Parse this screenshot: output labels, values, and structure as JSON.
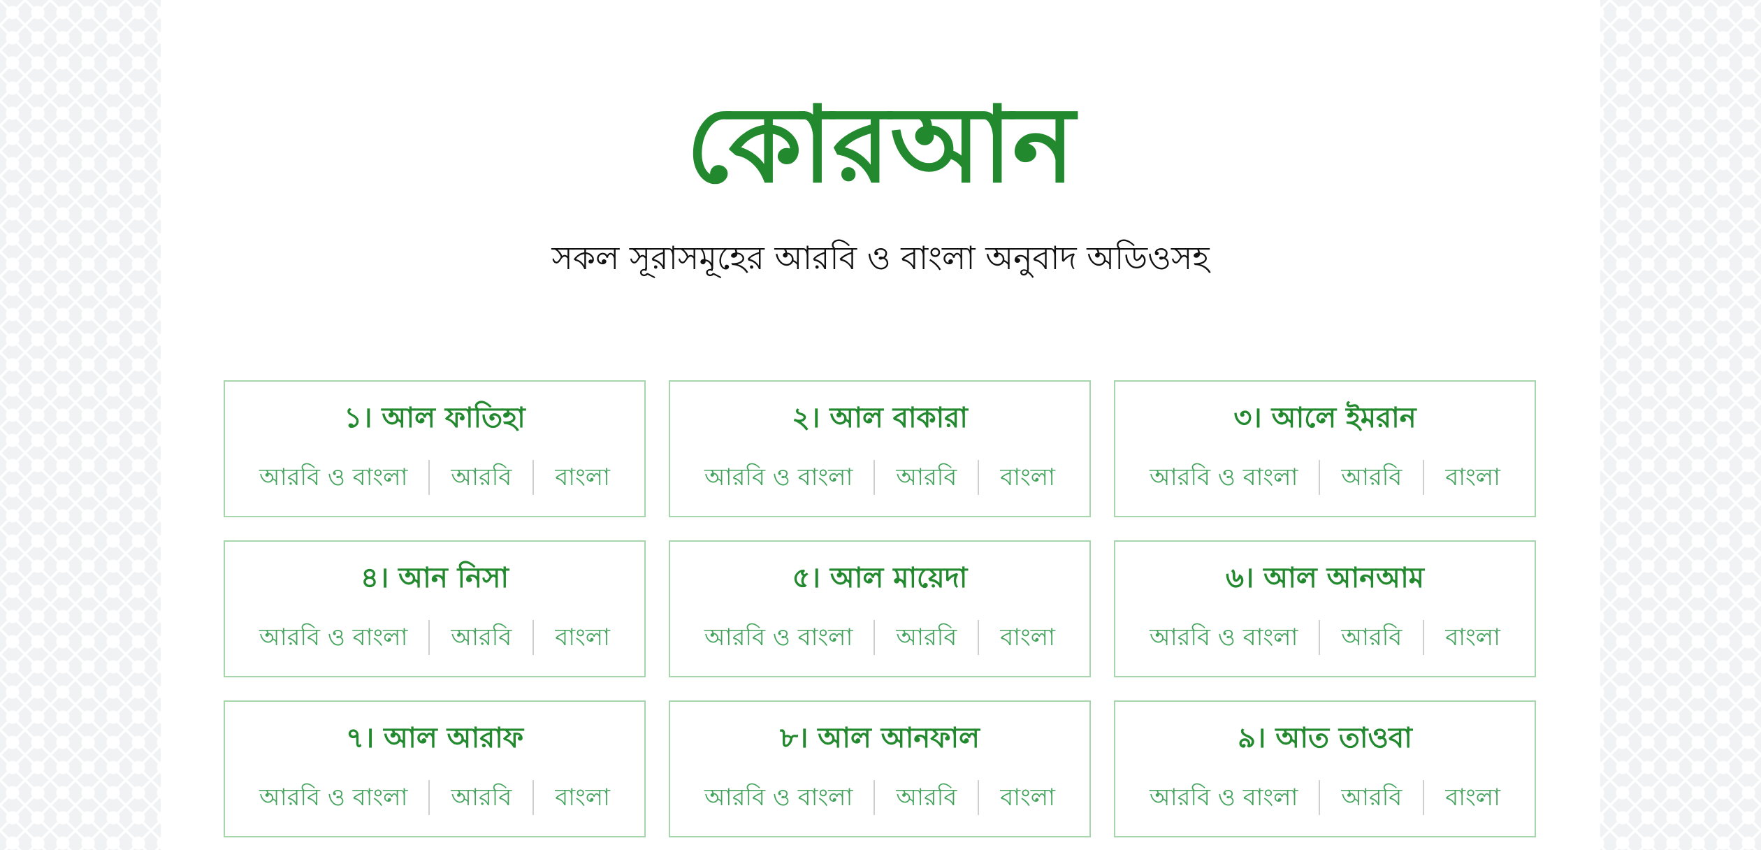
{
  "header": {
    "title": "কোরআন",
    "subtitle": "সকল সূরাসমূহের আরবি ও বাংলা অনুবাদ অডিওসহ"
  },
  "link_labels": {
    "both": "আরবি ও বাংলা",
    "arabic": "আরবি",
    "bangla": "বাংলা"
  },
  "surahs": [
    {
      "title": "১। আল ফাতিহা"
    },
    {
      "title": "২। আল বাকারা"
    },
    {
      "title": "৩। আলে ইমরান"
    },
    {
      "title": "৪। আন নিসা"
    },
    {
      "title": "৫। আল মায়েদা"
    },
    {
      "title": "৬। আল আনআম"
    },
    {
      "title": "৭। আল আরাফ"
    },
    {
      "title": "৮। আল আনফাল"
    },
    {
      "title": "৯। আত তাওবা"
    }
  ],
  "colors": {
    "accent_green": "#23892e",
    "link_green": "#43a35c",
    "card_border": "#a7d5ac"
  }
}
